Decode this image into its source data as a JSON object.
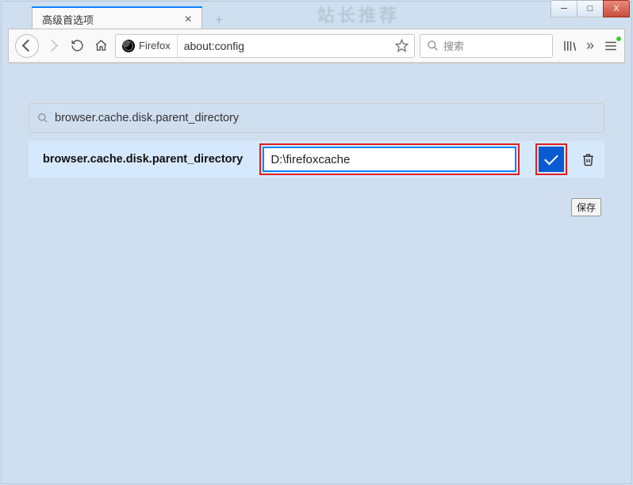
{
  "window": {
    "bg_hint_text": "站长推荐",
    "controls": {
      "min": "─",
      "max": "□",
      "close": "X"
    }
  },
  "tabs": {
    "active_title": "高级首选项",
    "close_label": "×",
    "newtab_label": "+"
  },
  "toolbar": {
    "identity_label": "Firefox",
    "url": "about:config",
    "search_placeholder": "搜索"
  },
  "config": {
    "filter_value": "browser.cache.disk.parent_directory",
    "pref_name": "browser.cache.disk.parent_directory",
    "pref_value": "D:\\firefoxcache",
    "save_tooltip": "保存"
  }
}
